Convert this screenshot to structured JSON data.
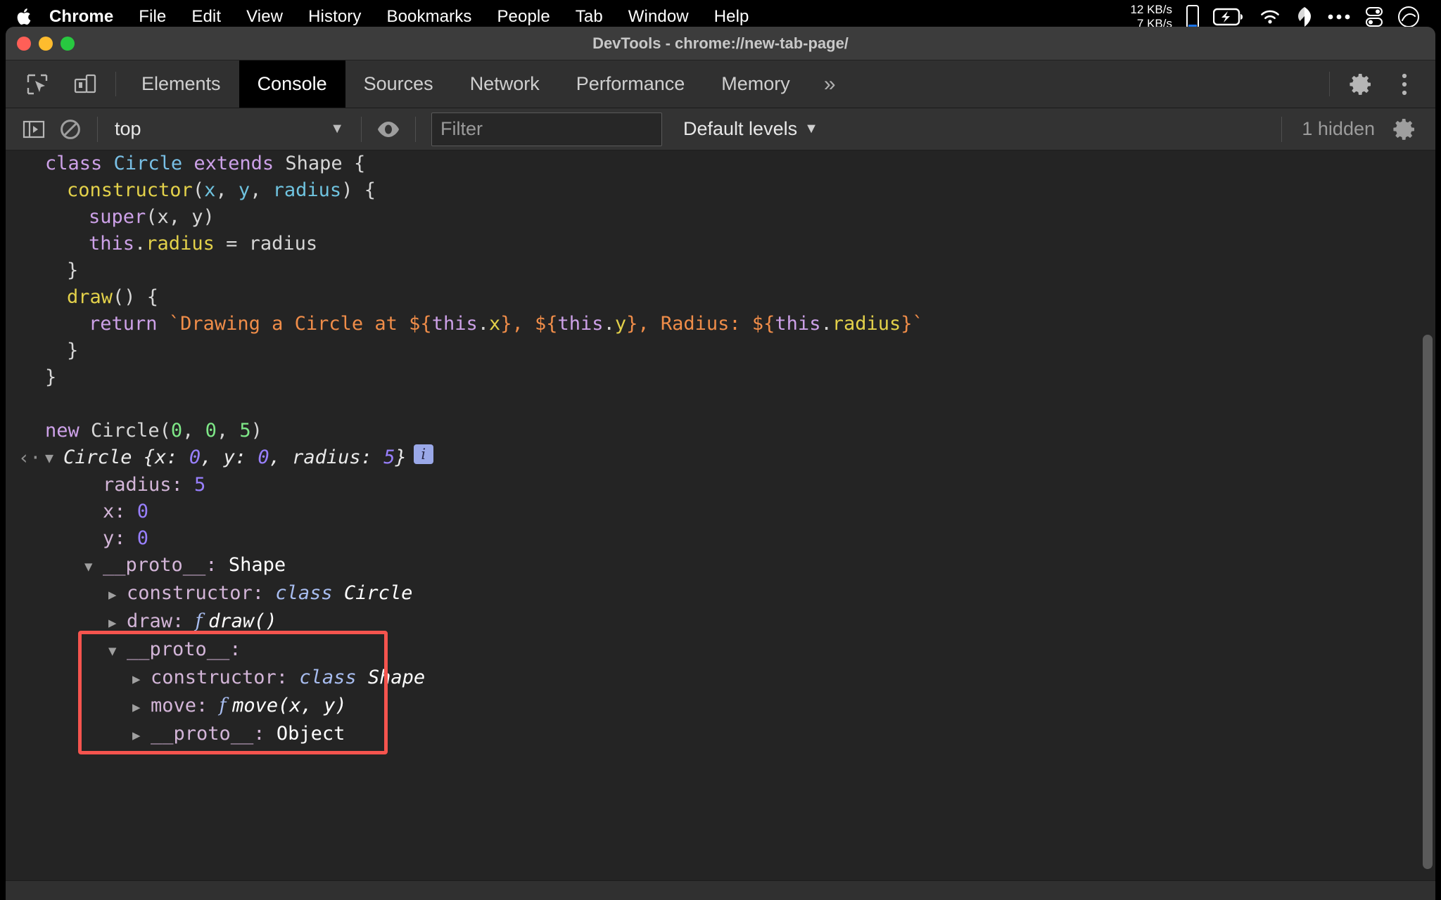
{
  "menubar": {
    "apple_icon": "apple-logo",
    "items": [
      "Chrome",
      "File",
      "Edit",
      "View",
      "History",
      "Bookmarks",
      "People",
      "Tab",
      "Window",
      "Help"
    ],
    "network_up": "12 KB/s",
    "network_down": "7 KB/s",
    "status_icons": [
      "iphone-icon",
      "battery-charging-icon",
      "wifi-icon",
      "dropbox-icon",
      "ellipsis-icon",
      "control-center-icon",
      "siri-icon"
    ]
  },
  "window": {
    "title": "DevTools - chrome://new-tab-page/",
    "traffic_lights": [
      "close",
      "minimize",
      "maximize"
    ]
  },
  "devtools": {
    "left_icons": [
      "inspect-element-icon",
      "device-toolbar-icon"
    ],
    "tabs": [
      {
        "label": "Elements",
        "active": false
      },
      {
        "label": "Console",
        "active": true
      },
      {
        "label": "Sources",
        "active": false
      },
      {
        "label": "Network",
        "active": false
      },
      {
        "label": "Performance",
        "active": false
      },
      {
        "label": "Memory",
        "active": false
      }
    ],
    "more_tabs": "»",
    "right_icons": [
      "settings-gear-icon",
      "more-options-icon"
    ]
  },
  "console_toolbar": {
    "sidebar_toggle": "console-sidebar-icon",
    "clear_console": "clear-console-icon",
    "context": "top",
    "context_caret": "▼",
    "eye_icon": "live-expression-icon",
    "filter_placeholder": "Filter",
    "filter_value": "",
    "levels_label": "Default levels",
    "levels_caret": "▼",
    "hidden_label": "1 hidden",
    "settings_icon": "console-settings-gear-icon"
  },
  "console": {
    "input_lines": [
      {
        "indent": 0,
        "tokens": [
          {
            "t": "class ",
            "c": "tok-kw"
          },
          {
            "t": "Circle",
            "c": "tok-class"
          },
          {
            "t": " ",
            "c": "tok-plain"
          },
          {
            "t": "extends",
            "c": "tok-kw"
          },
          {
            "t": " Shape {",
            "c": "tok-plain"
          }
        ]
      },
      {
        "indent": 1,
        "tokens": [
          {
            "t": "constructor",
            "c": "tok-fn"
          },
          {
            "t": "(",
            "c": "tok-plain"
          },
          {
            "t": "x",
            "c": "tok-param"
          },
          {
            "t": ", ",
            "c": "tok-plain"
          },
          {
            "t": "y",
            "c": "tok-param"
          },
          {
            "t": ", ",
            "c": "tok-plain"
          },
          {
            "t": "radius",
            "c": "tok-param"
          },
          {
            "t": ") {",
            "c": "tok-plain"
          }
        ]
      },
      {
        "indent": 2,
        "tokens": [
          {
            "t": "super",
            "c": "tok-kw"
          },
          {
            "t": "(x, y)",
            "c": "tok-plain"
          }
        ]
      },
      {
        "indent": 2,
        "tokens": [
          {
            "t": "this",
            "c": "tok-kw"
          },
          {
            "t": ".",
            "c": "tok-plain"
          },
          {
            "t": "radius",
            "c": "tok-fn"
          },
          {
            "t": " = radius",
            "c": "tok-plain"
          }
        ]
      },
      {
        "indent": 1,
        "tokens": [
          {
            "t": "}",
            "c": "tok-plain"
          }
        ]
      },
      {
        "indent": 1,
        "tokens": [
          {
            "t": "draw",
            "c": "tok-fn"
          },
          {
            "t": "() {",
            "c": "tok-plain"
          }
        ]
      },
      {
        "indent": 2,
        "tokens": [
          {
            "t": "return",
            "c": "tok-kw"
          },
          {
            "t": " ",
            "c": "tok-plain"
          },
          {
            "t": "`Drawing a Circle at ${",
            "c": "tok-str"
          },
          {
            "t": "this",
            "c": "tok-kw"
          },
          {
            "t": ".",
            "c": "tok-plain"
          },
          {
            "t": "x",
            "c": "tok-fn"
          },
          {
            "t": "}, ${",
            "c": "tok-str"
          },
          {
            "t": "this",
            "c": "tok-kw"
          },
          {
            "t": ".",
            "c": "tok-plain"
          },
          {
            "t": "y",
            "c": "tok-fn"
          },
          {
            "t": "}, Radius: ${",
            "c": "tok-str"
          },
          {
            "t": "this",
            "c": "tok-kw"
          },
          {
            "t": ".",
            "c": "tok-plain"
          },
          {
            "t": "radius",
            "c": "tok-fn"
          },
          {
            "t": "}`",
            "c": "tok-str"
          }
        ]
      },
      {
        "indent": 1,
        "tokens": [
          {
            "t": "}",
            "c": "tok-plain"
          }
        ]
      },
      {
        "indent": 0,
        "tokens": [
          {
            "t": "}",
            "c": "tok-plain"
          }
        ]
      },
      {
        "indent": 0,
        "tokens": [
          {
            "t": "",
            "c": "tok-plain"
          }
        ]
      },
      {
        "indent": 0,
        "tokens": [
          {
            "t": "new",
            "c": "tok-kw"
          },
          {
            "t": " Circle(",
            "c": "tok-plain"
          },
          {
            "t": "0",
            "c": "tok-num"
          },
          {
            "t": ", ",
            "c": "tok-plain"
          },
          {
            "t": "0",
            "c": "tok-num"
          },
          {
            "t": ", ",
            "c": "tok-plain"
          },
          {
            "t": "5",
            "c": "tok-num"
          },
          {
            "t": ")",
            "c": "tok-plain"
          }
        ]
      }
    ],
    "result": {
      "return_arrow": "‹·",
      "disclosure": "▼",
      "preview_prefix": "Circle ",
      "preview": "{x: 0, y: 0, radius: 5}",
      "preview_parts": [
        {
          "t": "Circle ",
          "c": "obj"
        },
        {
          "t": "{x: ",
          "c": "obj"
        },
        {
          "t": "0",
          "c": "num"
        },
        {
          "t": ", y: ",
          "c": "obj"
        },
        {
          "t": "0",
          "c": "num"
        },
        {
          "t": ", radius: ",
          "c": "obj"
        },
        {
          "t": "5",
          "c": "num"
        },
        {
          "t": "}",
          "c": "obj"
        }
      ],
      "info_badge": "i"
    },
    "properties": [
      {
        "indent": 1,
        "disclosure": "none",
        "name": "radius",
        "sep": ": ",
        "value": "5",
        "value_kind": "num"
      },
      {
        "indent": 1,
        "disclosure": "none",
        "name": "x",
        "sep": ": ",
        "value": "0",
        "value_kind": "num"
      },
      {
        "indent": 1,
        "disclosure": "none",
        "name": "y",
        "sep": ": ",
        "value": "0",
        "value_kind": "num"
      },
      {
        "indent": 1,
        "disclosure": "open",
        "name": "__proto__",
        "sep": ": ",
        "value": "Shape",
        "value_kind": "white"
      },
      {
        "indent": 2,
        "disclosure": "closed",
        "name": "constructor",
        "sep": ": ",
        "value": "class Circle",
        "value_kind": "class"
      },
      {
        "indent": 2,
        "disclosure": "closed",
        "name": "draw",
        "sep": ": ",
        "value": "f draw()",
        "value_kind": "fn"
      },
      {
        "indent": 2,
        "disclosure": "open",
        "name": "__proto__",
        "sep": ":",
        "value": "",
        "value_kind": "none",
        "highlighted": true
      },
      {
        "indent": 3,
        "disclosure": "closed",
        "name": "constructor",
        "sep": ": ",
        "value": "class Shape",
        "value_kind": "class",
        "highlighted": true
      },
      {
        "indent": 3,
        "disclosure": "closed",
        "name": "move",
        "sep": ": ",
        "value": "f move(x, y)",
        "value_kind": "fn",
        "highlighted": true
      },
      {
        "indent": 3,
        "disclosure": "closed",
        "name": "__proto__",
        "sep": ": ",
        "value": "Object",
        "value_kind": "white",
        "highlighted": true
      }
    ],
    "annotation": {
      "color": "#f5544e",
      "label": "prototype-chain-highlight"
    }
  },
  "colors": {
    "window_bg": "#2b2b2b",
    "console_bg": "#242424",
    "toolbar_bg": "#333333",
    "tabstrip_bg": "#303030",
    "active_tab_bg": "#000000",
    "annotation_red": "#f5544e",
    "number_purple": "#9980ff",
    "string_orange": "#f08d49",
    "keyword_purple": "#cda1e8"
  }
}
